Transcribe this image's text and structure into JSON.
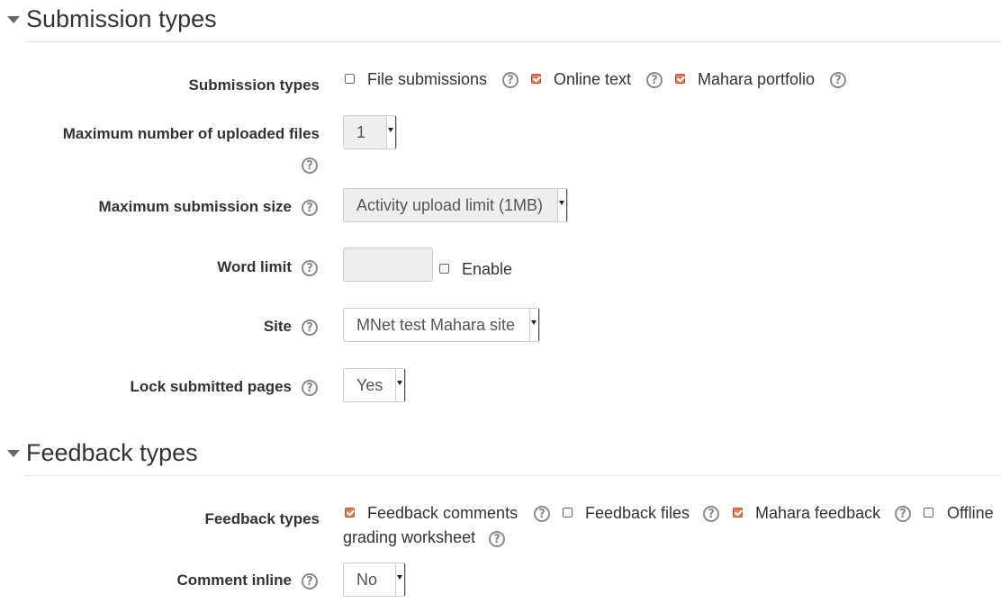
{
  "submission_section": {
    "title": "Submission types",
    "types_label": "Submission types",
    "types_options": [
      {
        "label": "File submissions",
        "checked": false
      },
      {
        "label": "Online text",
        "checked": true
      },
      {
        "label": "Mahara portfolio",
        "checked": true
      }
    ],
    "max_files_label": "Maximum number of uploaded files",
    "max_files_value": "1",
    "max_size_label": "Maximum submission size",
    "max_size_value": "Activity upload limit (1MB)",
    "word_limit_label": "Word limit",
    "word_limit_value": "",
    "word_limit_enable_label": "Enable",
    "site_label": "Site",
    "site_value": "MNet test Mahara site",
    "lock_label": "Lock submitted pages",
    "lock_value": "Yes"
  },
  "feedback_section": {
    "title": "Feedback types",
    "types_label": "Feedback types",
    "types_options": [
      {
        "label": "Feedback comments",
        "checked": true
      },
      {
        "label": "Feedback files",
        "checked": false
      },
      {
        "label": "Mahara feedback",
        "checked": true
      },
      {
        "label": "Offline",
        "checked": false
      }
    ],
    "offline_continuation": "grading worksheet",
    "comment_inline_label": "Comment inline",
    "comment_inline_value": "No"
  },
  "colors": {
    "accent_check": "#e0805a",
    "help_icon": "#8a8a8a",
    "text": "#333333"
  },
  "icons": {
    "help": "question-circle-icon",
    "collapse": "caret-down-icon"
  }
}
